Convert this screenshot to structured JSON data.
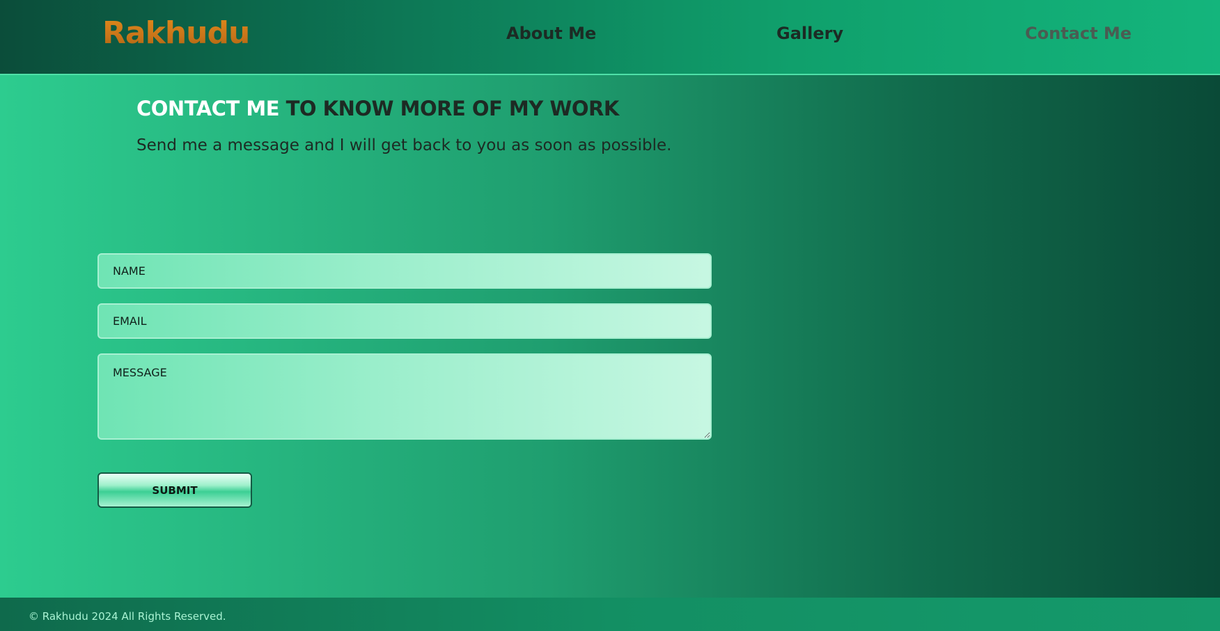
{
  "header": {
    "logo": "Rakhudu",
    "nav": {
      "about": "About Me",
      "gallery": "Gallery",
      "contact": "Contact Me"
    }
  },
  "main": {
    "title_highlight": "CONTACT ME",
    "title_rest": " TO KNOW MORE OF MY WORK",
    "subtitle": "Send me a message and I will get back to you as soon as possible."
  },
  "form": {
    "name_placeholder": "NAME",
    "email_placeholder": "EMAIL",
    "message_placeholder": "MESSAGE",
    "submit_label": "SUBMIT"
  },
  "footer": {
    "copyright": "© Rakhudu 2024 All Rights Reserved."
  },
  "colors": {
    "logo": "#c8741a",
    "active_nav": "#4a5c52",
    "title_highlight": "#ffffff"
  }
}
